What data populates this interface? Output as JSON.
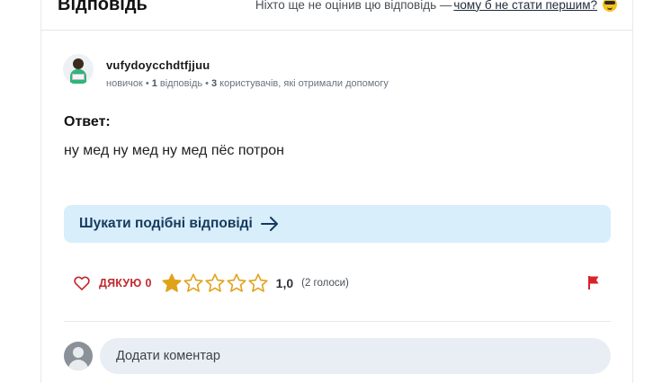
{
  "header": {
    "title": "Відповідь",
    "rate_note_prefix": "Ніхто ще не оцінив цю відповідь —",
    "rate_note_link": "чому б не стати першим?",
    "emoji_icon": "sunglasses-emoji-icon"
  },
  "author": {
    "username": "vufydoycchdtfjjuu",
    "rank": "новичок",
    "answers_count": "1",
    "answers_label": "відповідь",
    "helped_count": "3",
    "helped_label": "користувачів, які отримали допомогу"
  },
  "answer": {
    "label": "Ответ:",
    "text": "ну мед ну мед ну мед пёс потрон"
  },
  "similar_button": {
    "label": "Шукати подібні відповіді",
    "icon": "arrow-right-icon"
  },
  "actions": {
    "thanks_label": "ДЯКУЮ",
    "thanks_count": "0",
    "rating_value": "1,0",
    "votes_text": "(2 голоси)",
    "stars_filled": 1,
    "stars_total": 5,
    "flag_icon": "report-flag-icon"
  },
  "comment": {
    "placeholder": "Додати коментар"
  },
  "colors": {
    "accent_blue_bg": "#d9eefb",
    "accent_blue_text": "#163a5f",
    "thanks_red": "#c2292d",
    "star_gold": "#e0a21a",
    "flag_red": "#d8232a"
  }
}
